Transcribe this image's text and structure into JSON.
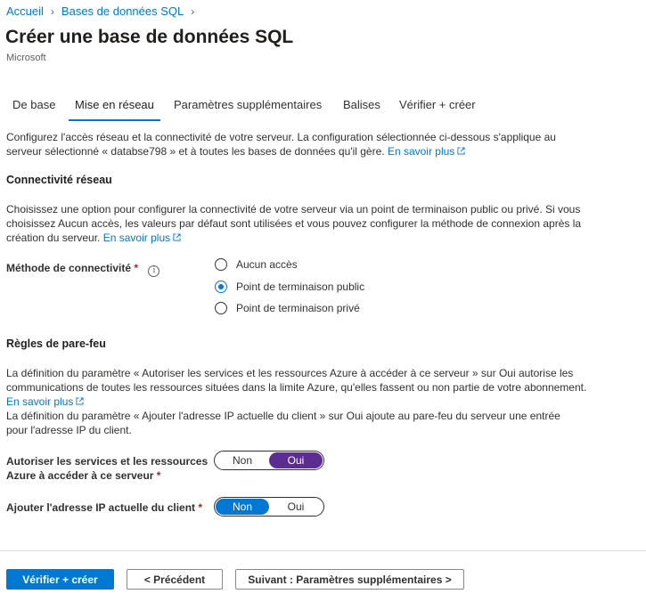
{
  "breadcrumb": {
    "home": "Accueil",
    "current": "Bases de données SQL"
  },
  "page": {
    "title": "Créer une base de données SQL",
    "subtitle": "Microsoft"
  },
  "tabs": [
    "De base",
    "Mise en réseau",
    "Paramètres supplémentaires",
    "Balises",
    "Vérifier + créer"
  ],
  "active_tab": "Mise en réseau",
  "intro": {
    "line1": "Configurez l'accès réseau et la connectivité de votre serveur. La configuration sélectionnée ci-dessous s'applique au",
    "line2": "serveur sélectionné « databse798 » et à toutes les bases de données qu'il gère.",
    "link": "En savoir plus"
  },
  "connectivity": {
    "title": "Connectivité réseau",
    "line1": "Choisissez une option pour configurer la connectivité de votre serveur via un point de terminaison public ou privé. Si vous",
    "line2": "choisissez Aucun accès, les valeurs par défaut sont utilisées et vous pouvez configurer la méthode de connexion après la",
    "line3": "création du serveur.",
    "link": "En savoir plus",
    "method_label": "Méthode de connectivité",
    "required_mark": "*",
    "info_icon": "i",
    "options": [
      "Aucun accès",
      "Point de terminaison public",
      "Point de terminaison privé"
    ],
    "selected": "Point de terminaison public"
  },
  "firewall": {
    "title": "Règles de pare-feu",
    "line1": "La définition du paramètre « Autoriser les services et les ressources Azure à accéder à ce serveur » sur Oui autorise les",
    "line2": "communications de toutes les ressources situées dans la limite Azure, qu'elles fassent ou non partie de votre abonnement.",
    "link": "En savoir plus",
    "line3": "La définition du paramètre « Ajouter l'adresse IP actuelle du client » sur Oui ajoute au pare-feu du serveur une entrée",
    "line4": "pour l'adresse IP du client.",
    "allow_azure": {
      "label_line1": "Autoriser les services et les ressources",
      "label_line2": "Azure à accéder à ce serveur",
      "required_mark": "*",
      "off": "Non",
      "on": "Oui",
      "value": "Oui"
    },
    "add_client_ip": {
      "label": "Ajouter l'adresse IP actuelle du client",
      "required_mark": "*",
      "off": "Non",
      "on": "Oui",
      "value": "Non"
    }
  },
  "footer": {
    "review_create": "Vérifier + créer",
    "previous": "< Précédent",
    "next": "Suivant : Paramètres supplémentaires >"
  },
  "colors": {
    "accent": "#0078d4",
    "toggle_on": "#5c2d91",
    "required": "#a4262c"
  }
}
